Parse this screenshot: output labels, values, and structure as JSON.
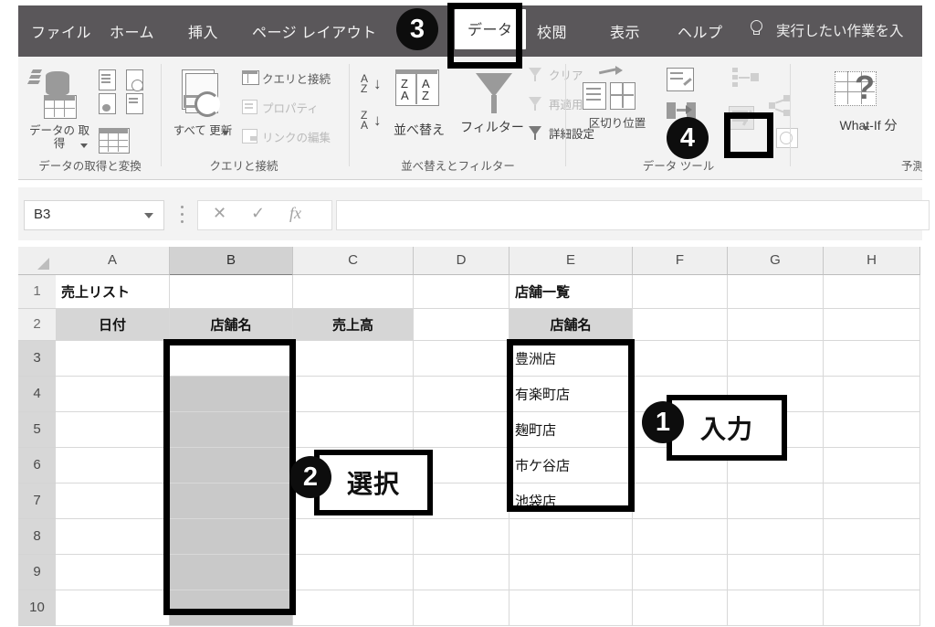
{
  "app": {
    "name_box_value": "B3",
    "formula_bar_value": ""
  },
  "ribbon": {
    "tabs": [
      {
        "label": "ファイル",
        "active": false
      },
      {
        "label": "ホーム",
        "active": false
      },
      {
        "label": "挿入",
        "active": false
      },
      {
        "label": "ページ レイアウト",
        "active": false
      },
      {
        "label": "データ",
        "active": true
      },
      {
        "label": "校閲",
        "active": false
      },
      {
        "label": "表示",
        "active": false
      },
      {
        "label": "ヘルプ",
        "active": false
      }
    ],
    "tell_me": "実行したい作業を入",
    "tell_me_icon": "lightbulb-icon",
    "groups": [
      {
        "name": "データの取得と変換",
        "big_button": "データの 取得",
        "items": []
      },
      {
        "name": "クエリと接続",
        "big_button": "すべて 更新",
        "items": [
          {
            "label": "クエリと接続",
            "disabled": false
          },
          {
            "label": "プロパティ",
            "disabled": true
          },
          {
            "label": "リンクの編集",
            "disabled": true
          }
        ]
      },
      {
        "name": "並べ替えとフィルター",
        "big_button": "並べ替え",
        "big_button2": "フィルター",
        "items": [
          {
            "label": "クリア",
            "disabled": true
          },
          {
            "label": "再適用",
            "disabled": true
          },
          {
            "label": "詳細設定",
            "disabled": false
          }
        ]
      },
      {
        "name": "データ ツール",
        "big_button": "区切り位置",
        "items": []
      },
      {
        "name": "予測",
        "big_button": "What-If 分",
        "items": []
      }
    ]
  },
  "formula_bar": {
    "cancel_icon": "✕",
    "confirm_icon": "✓",
    "function_icon": "fx"
  },
  "sheet": {
    "columns": [
      "A",
      "B",
      "C",
      "D",
      "E",
      "F",
      "G",
      "H"
    ],
    "selected_column": "B",
    "rows": [
      "1",
      "2",
      "3",
      "4",
      "5",
      "6",
      "7",
      "8",
      "9",
      "10"
    ],
    "selected_rows": [
      "3",
      "4",
      "5",
      "6",
      "7",
      "8",
      "9",
      "10"
    ],
    "cells": {
      "A1": "売上リスト",
      "A2": "日付",
      "B2": "店舗名",
      "C2": "売上高",
      "E1": "店舗一覧",
      "E2": "店舗名",
      "E3": "豊洲店",
      "E4": "有楽町店",
      "E5": "麹町店",
      "E6": "市ケ谷店",
      "E7": "池袋店"
    },
    "active_cell": "B3",
    "selection_range": "B3:B10"
  },
  "annotations": [
    {
      "number": "1",
      "label": "入力",
      "target": "store-list-range-E3-E7"
    },
    {
      "number": "2",
      "label": "選択",
      "target": "column-b-selection-B3-B10"
    },
    {
      "number": "3",
      "label": "",
      "target": "data-tab"
    },
    {
      "number": "4",
      "label": "",
      "target": "data-validation-button"
    }
  ],
  "colors": {
    "ribbon_bg": "#5a575a",
    "ribbon_body": "#f3f3f3",
    "annotation": "#000000",
    "selection_fill": "#c9c9c9",
    "header_fill": "#d6d6d6"
  }
}
